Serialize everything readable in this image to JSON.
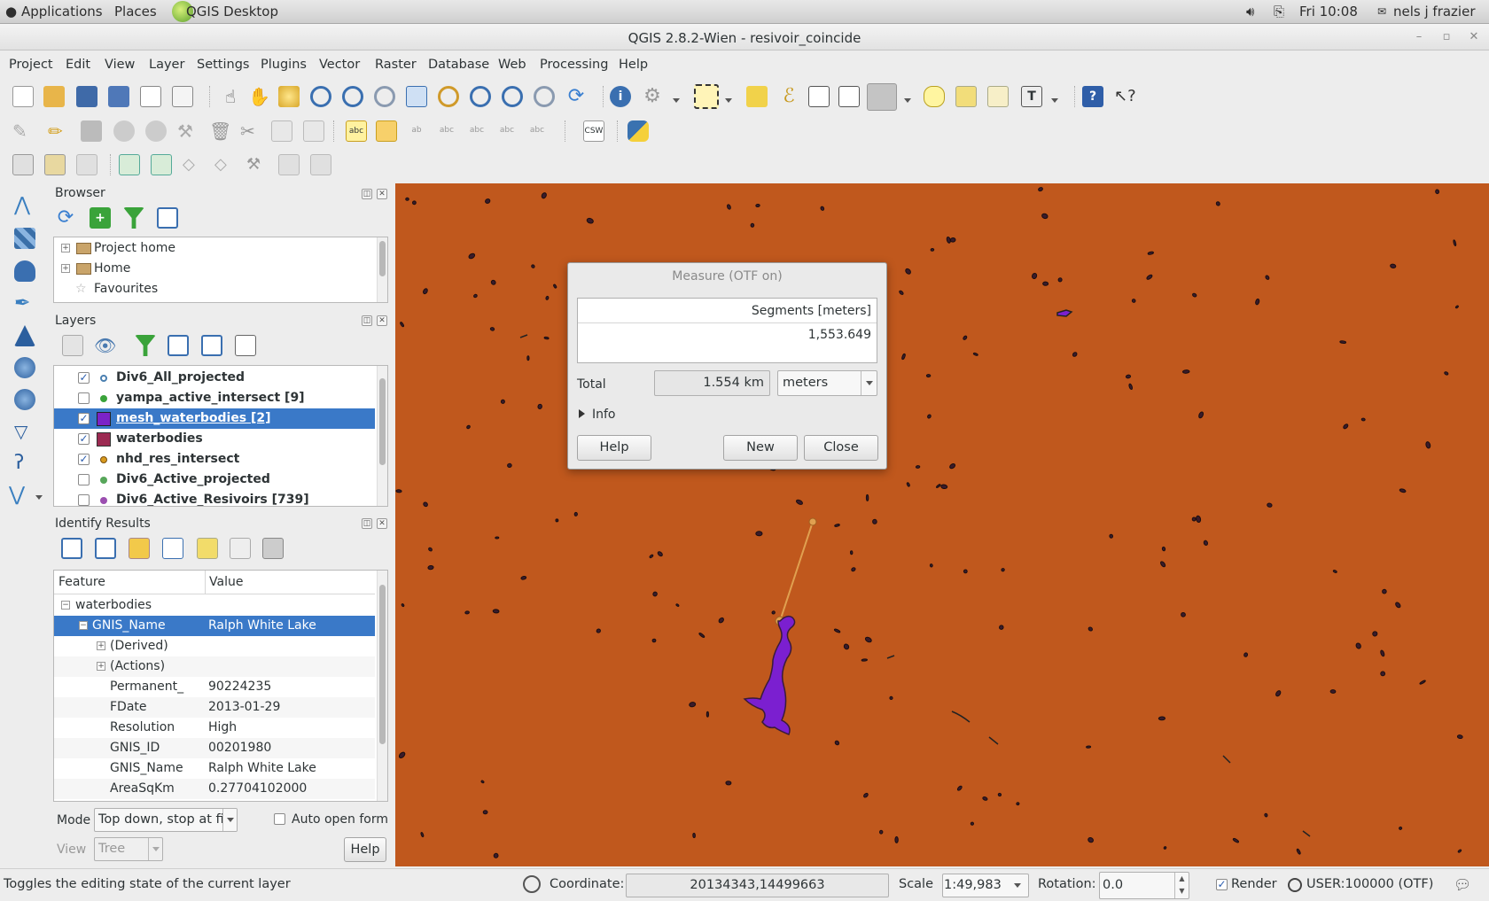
{
  "topbar": {
    "applications": "Applications",
    "places": "Places",
    "app_name": "QGIS Desktop",
    "clock": "Fri 10:08",
    "user": "nels j frazier"
  },
  "window": {
    "title": "QGIS 2.8.2-Wien - resivoir_coincide"
  },
  "menubar": [
    "Project",
    "Edit",
    "View",
    "Layer",
    "Settings",
    "Plugins",
    "Vector",
    "Raster",
    "Database",
    "Web",
    "Processing",
    "Help"
  ],
  "browser": {
    "title": "Browser",
    "items": [
      "Project home",
      "Home",
      "Favourites"
    ]
  },
  "layers": {
    "title": "Layers",
    "items": [
      {
        "name": "Div6_All_projected",
        "checked": true,
        "symbol": "point",
        "color": "#4a7fb0"
      },
      {
        "name": "yampa_active_intersect [9]",
        "checked": false,
        "symbol": "point",
        "color": "#3aa33a"
      },
      {
        "name": "mesh_waterbodies [2]",
        "checked": true,
        "symbol": "polygon",
        "color": "#7b22c8"
      },
      {
        "name": "waterbodies",
        "checked": true,
        "symbol": "polygon",
        "color": "#9c2a52"
      },
      {
        "name": "nhd_res_intersect",
        "checked": true,
        "symbol": "point",
        "color": "#d89a1e"
      },
      {
        "name": "Div6_Active_projected",
        "checked": false,
        "symbol": "point",
        "color": "#57a65a"
      },
      {
        "name": "Div6_Active_Resivoirs [739]",
        "checked": false,
        "symbol": "point",
        "color": "#9b4fb0"
      }
    ]
  },
  "identify": {
    "title": "Identify Results",
    "col_feature": "Feature",
    "col_value": "Value",
    "layer": "waterbodies",
    "selected_field": "GNIS_Name",
    "selected_value": "Ralph White Lake",
    "groups": [
      "(Derived)",
      "(Actions)"
    ],
    "attributes": [
      {
        "field": "Permanent_",
        "value": "90224235"
      },
      {
        "field": "FDate",
        "value": "2013-01-29"
      },
      {
        "field": "Resolution",
        "value": "High"
      },
      {
        "field": "GNIS_ID",
        "value": "00201980"
      },
      {
        "field": "GNIS_Name",
        "value": "Ralph White Lake"
      },
      {
        "field": "AreaSqKm",
        "value": "0.27704102000"
      }
    ],
    "mode_label": "Mode",
    "mode_value": "Top down, stop at firs",
    "auto_open_label": "Auto open form",
    "view_label": "View",
    "view_value": "Tree",
    "help_label": "Help"
  },
  "measure": {
    "title": "Measure (OTF on)",
    "header": "Segments [meters]",
    "segment": "1,553.649",
    "total_label": "Total",
    "total_value": "1.554 km",
    "unit": "meters",
    "info_label": "Info",
    "help_label": "Help",
    "new_label": "New",
    "close_label": "Close"
  },
  "status": {
    "message": "Toggles the editing state of the current layer",
    "coordinate_label": "Coordinate:",
    "coordinate": "20134343,14499663",
    "scale_label": "Scale",
    "scale": "1:49,983",
    "rotation_label": "Rotation:",
    "rotation": "0.0",
    "render_label": "Render",
    "crs": "USER:100000 (OTF)"
  },
  "colors": {
    "map_fill": "#c0581d",
    "selection": "#3a79c8",
    "lake_fill": "#7b1fd0",
    "measure_line": "#e0a050"
  }
}
